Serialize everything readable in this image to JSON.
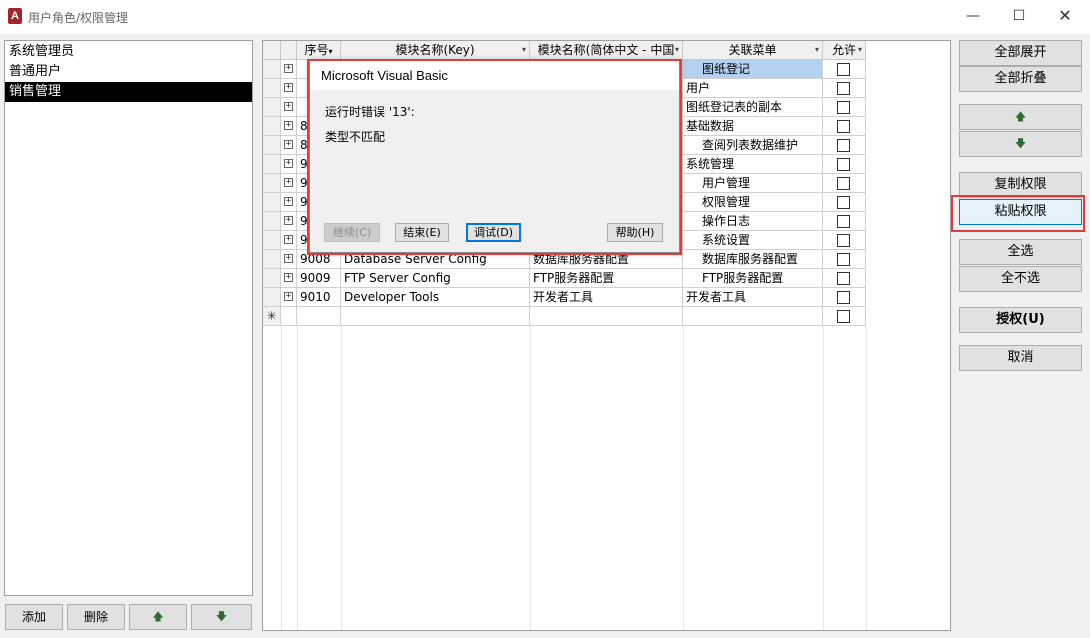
{
  "window": {
    "title": "用户角色/权限管理",
    "app_icon_letter": "A",
    "minimize": "—",
    "maximize": "☐",
    "close": "✕"
  },
  "roles": [
    {
      "label": "系统管理员",
      "selected": false
    },
    {
      "label": "普通用户",
      "selected": false
    },
    {
      "label": "销售管理",
      "selected": true
    }
  ],
  "role_buttons": {
    "add": "添加",
    "delete": "删除",
    "up": "🡅",
    "down": "🡇"
  },
  "grid": {
    "headers": {
      "no": "序号",
      "key": "模块名称(Key)",
      "cn": "模块名称(简体中文 - 中国",
      "menu": "关联菜单",
      "allow": "允许"
    },
    "rows": [
      {
        "no": "",
        "key": "",
        "cn": "",
        "menu": "图纸登记",
        "menu_indent": true,
        "highlight": true
      },
      {
        "no": "",
        "key": "",
        "cn": "",
        "menu": "用户",
        "menu_indent": false
      },
      {
        "no": "",
        "key": "",
        "cn": "",
        "menu": "图纸登记表的副本",
        "menu_indent": false
      },
      {
        "no": "8",
        "key": "",
        "cn": "",
        "menu": "基础数据",
        "menu_indent": false
      },
      {
        "no": "8",
        "key": "",
        "cn": "",
        "menu": "查阅列表数据维护",
        "menu_indent": true
      },
      {
        "no": "9",
        "key": "",
        "cn": "",
        "menu": "系统管理",
        "menu_indent": false
      },
      {
        "no": "9",
        "key": "",
        "cn": "",
        "menu": "用户管理",
        "menu_indent": true
      },
      {
        "no": "9",
        "key": "",
        "cn": "",
        "menu": "权限管理",
        "menu_indent": true
      },
      {
        "no": "9",
        "key": "",
        "cn": "",
        "menu": "操作日志",
        "menu_indent": true
      },
      {
        "no": "9",
        "key": "",
        "cn": "",
        "menu": "系统设置",
        "menu_indent": true
      },
      {
        "no": "9008",
        "key": "Database Server Config",
        "cn": "数据库服务器配置",
        "menu": "数据库服务器配置",
        "menu_indent": true
      },
      {
        "no": "9009",
        "key": "FTP Server Config",
        "cn": "FTP服务器配置",
        "menu": "FTP服务器配置",
        "menu_indent": true
      },
      {
        "no": "9010",
        "key": "Developer Tools",
        "cn": "开发者工具",
        "menu": "开发者工具",
        "menu_indent": false
      }
    ],
    "new_row_marker": "✳"
  },
  "right_buttons": {
    "expand_all": "全部展开",
    "collapse_all": "全部折叠",
    "move_up": "🡅",
    "move_down": "🡇",
    "copy_perm": "复制权限",
    "paste_perm": "粘贴权限",
    "select_all": "全选",
    "select_none": "全不选",
    "authorize": "授权(U)",
    "cancel": "取消"
  },
  "dialog": {
    "title": "Microsoft Visual Basic",
    "message1": "运行时错误 '13':",
    "message2": "类型不匹配",
    "btn_continue": "继续(C)",
    "btn_end": "结束(E)",
    "btn_debug": "调试(D)",
    "btn_help": "帮助(H)"
  },
  "colors": {
    "highlight_box": "#e03c3c",
    "selection": "#000000",
    "row_highlight": "#b3d1f0",
    "focus": "#0078d7"
  }
}
